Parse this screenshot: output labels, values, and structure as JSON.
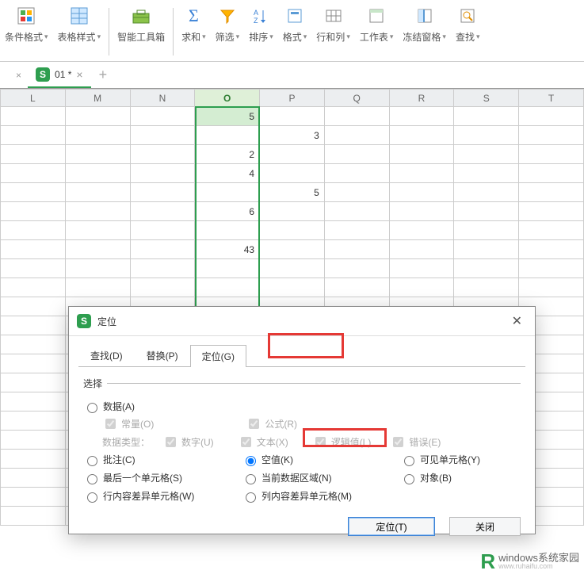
{
  "toolbar": {
    "cond_format": "条件格式",
    "table_style": "表格样式",
    "smart_toolbox": "智能工具箱",
    "sum": "求和",
    "filter": "筛选",
    "sort": "排序",
    "format": "格式",
    "row_col": "行和列",
    "worksheet": "工作表",
    "freeze": "冻结窗格",
    "find": "查找"
  },
  "workbook": {
    "tab_name": "01 *",
    "columns": [
      "L",
      "M",
      "N",
      "O",
      "P",
      "Q",
      "R",
      "S",
      "T"
    ],
    "selected_col_index": 3,
    "rows": [
      {
        "O": "5",
        "P": ""
      },
      {
        "O": "",
        "P": "3"
      },
      {
        "O": "2",
        "P": ""
      },
      {
        "O": "4",
        "P": ""
      },
      {
        "O": "",
        "P": "5"
      },
      {
        "O": "6",
        "P": ""
      },
      {
        "O": "",
        "P": ""
      },
      {
        "O": "43",
        "P": ""
      },
      {
        "O": "",
        "P": ""
      }
    ]
  },
  "dialog": {
    "title": "定位",
    "tabs": {
      "find": "查找(D)",
      "replace": "替换(P)",
      "goto": "定位(G)"
    },
    "section_label": "选择",
    "options": {
      "data": "数据(A)",
      "constant": "常量(O)",
      "formula": "公式(R)",
      "data_type_label": "数据类型：",
      "number": "数字(U)",
      "text": "文本(X)",
      "logical": "逻辑值(L)",
      "error": "错误(E)",
      "comment": "批注(C)",
      "blank": "空值(K)",
      "visible": "可见单元格(Y)",
      "last_cell": "最后一个单元格(S)",
      "current_region": "当前数据区域(N)",
      "object": "对象(B)",
      "row_diff": "行内容差异单元格(W)",
      "col_diff": "列内容差异单元格(M)"
    },
    "buttons": {
      "go": "定位(T)",
      "close": "关闭"
    }
  },
  "watermark": {
    "letter": "R",
    "brand": "windows系统家园",
    "sub": "www.ruhaifu.com"
  }
}
